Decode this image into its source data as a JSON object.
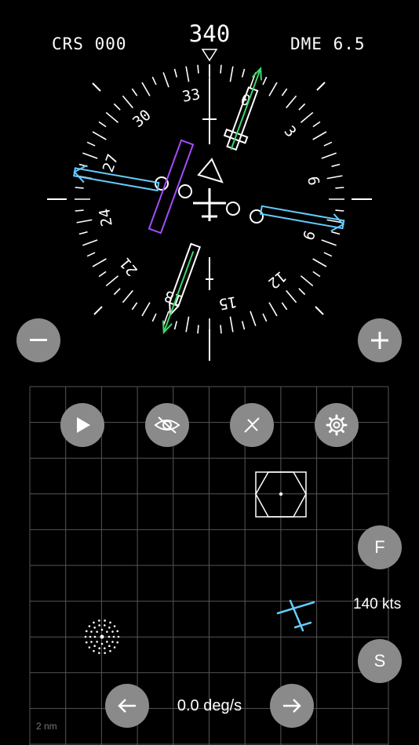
{
  "header": {
    "course_label": "CRS 000",
    "dme_label": "DME 6.5",
    "heading": "340"
  },
  "compass": {
    "heading_deg": 340,
    "course_deg": 0,
    "bearing_deg": 280,
    "labels": [
      "33",
      "0",
      "3",
      "6",
      "9",
      "12",
      "15",
      "18",
      "21",
      "24",
      "27",
      "30"
    ],
    "colors": {
      "needle": "#3dd66b",
      "bearing": "#66ccff",
      "station": "#a64dff",
      "marks": "#ffffff"
    }
  },
  "controls": {
    "zoom_out_icon": "minus-icon",
    "zoom_in_icon": "plus-icon",
    "play_icon": "play-icon",
    "hide_icon": "eye-slash-icon",
    "course_icon": "wand-icon",
    "settings_icon": "gear-icon",
    "f_label": "F",
    "s_label": "S"
  },
  "map": {
    "speed": "140 kts",
    "turn_rate": "0.0 deg/s",
    "scale": "2 nm",
    "colors": {
      "aircraft": "#66ccff",
      "grid": "#555555"
    }
  }
}
